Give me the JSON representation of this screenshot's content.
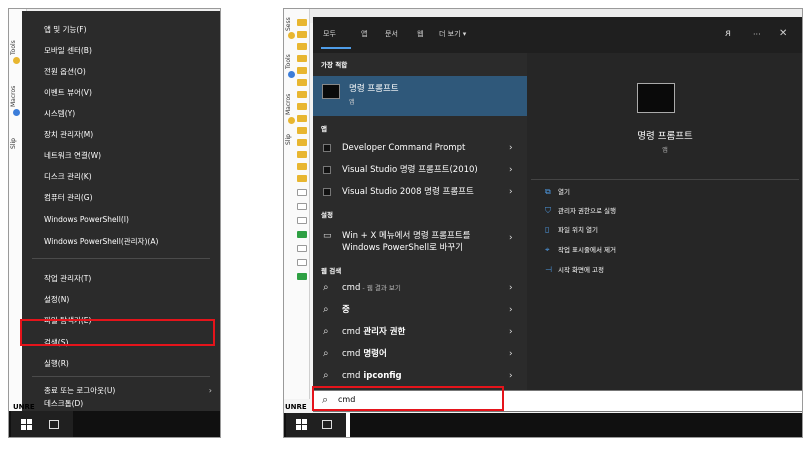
{
  "colors": {
    "highlight_red": "#e5141b",
    "menu_bg": "#2b2b2b",
    "best_match_bg": "#2f587a",
    "accent_blue": "#4f9de8"
  },
  "left": {
    "sidebar_labels": [
      "Tools",
      "Macros",
      "Slip"
    ],
    "bottom_text": "UNRE",
    "menu_items": [
      "앱 및 기능(F)",
      "모바일 센터(B)",
      "전원 옵션(O)",
      "이벤트 뷰어(V)",
      "시스템(Y)",
      "장치 관리자(M)",
      "네트워크 연결(W)",
      "디스크 관리(K)",
      "컴퓨터 관리(G)",
      "Windows PowerShell(I)",
      "Windows PowerShell(관리자)(A)",
      "작업 관리자(T)",
      "설정(N)",
      "파일 탐색기(E)",
      "검색(S)",
      "실행(R)",
      "종료 또는 로그아웃(U)",
      "데스크톱(D)"
    ],
    "submenu_arrow": "›",
    "highlighted_item": "검색(S)"
  },
  "right": {
    "sidebar_labels": [
      "Sess",
      "Tools",
      "Macros",
      "Slip"
    ],
    "bottom_text": "UNRE",
    "tabs": [
      "모두",
      "앱",
      "문서",
      "웹",
      "더 보기 ▾"
    ],
    "header_icons": {
      "person": "ᴙ",
      "more": "···",
      "close": "✕"
    },
    "best_match_title": "가장 적합",
    "best_match": {
      "name": "명령 프롬프트",
      "type": "앱"
    },
    "apps_title": "앱",
    "apps": [
      "Developer Command Prompt",
      "Visual Studio 명령 프롬프트(2010)",
      "Visual Studio 2008 명령 프롬프트"
    ],
    "settings_title": "설정",
    "setting_item": {
      "line1": "Win + X 메뉴에서 명령 프롬프트를",
      "line2": "Windows PowerShell로 바꾸기"
    },
    "web_title": "웹 검색",
    "web_results": [
      {
        "bold": "",
        "text": "cmd",
        "muted": " - 웹 결과 보기"
      },
      {
        "bold": "중",
        "text": "",
        "muted": ""
      },
      {
        "bold": " 관리자 권한",
        "text": "cmd",
        "muted": ""
      },
      {
        "bold": " 명령어",
        "text": "cmd",
        "muted": ""
      },
      {
        "bold": " ipconfig",
        "text": "cmd",
        "muted": ""
      }
    ],
    "arrow": "›",
    "preview": {
      "title": "명령 프롬프트",
      "subtitle": "앱"
    },
    "actions": [
      {
        "icon": "open-icon",
        "glyph": "⧉",
        "label": "열기"
      },
      {
        "icon": "shield-icon",
        "glyph": "⛉",
        "label": "관리자 권한으로 실행"
      },
      {
        "icon": "file-location-icon",
        "glyph": "▯",
        "label": "파일 위치 열기"
      },
      {
        "icon": "unpin-taskbar-icon",
        "glyph": "⌖",
        "label": "작업 표시줄에서 제거"
      },
      {
        "icon": "pin-start-icon",
        "glyph": "⊣",
        "label": "시작 화면에 고정"
      }
    ],
    "search_query": "cmd"
  }
}
